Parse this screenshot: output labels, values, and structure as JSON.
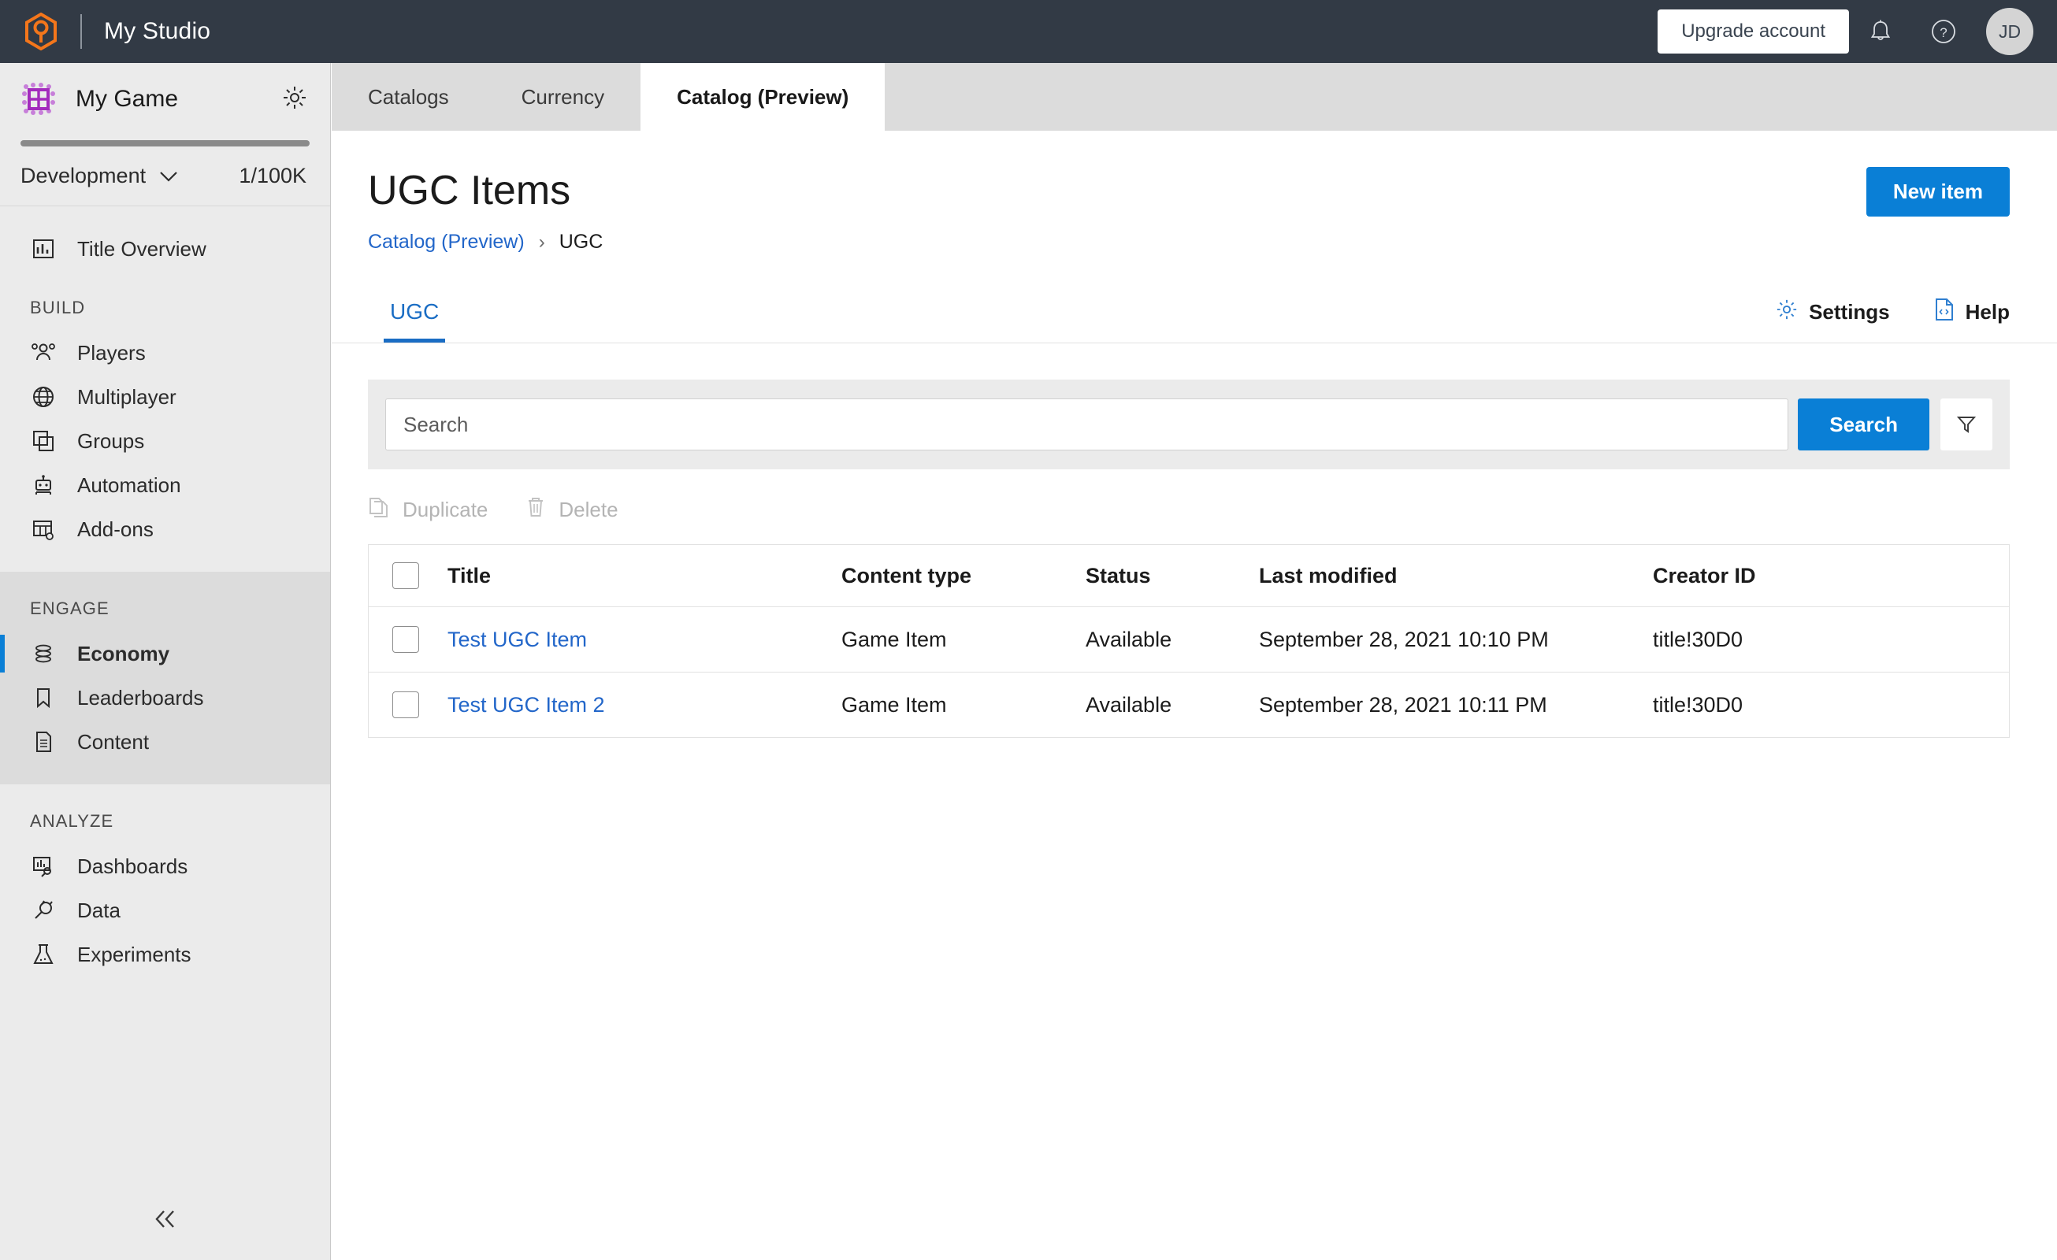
{
  "topbar": {
    "logo_icon": "playfab-hex-logo-icon",
    "studio_name": "My Studio",
    "upgrade_label": "Upgrade account",
    "bell_icon": "notification-bell-icon",
    "help_icon": "help-circle-icon",
    "avatar_initials": "JD",
    "bg_color": "#323a45",
    "logo_color": "#f4761b"
  },
  "sidebar": {
    "game_name": "My Game",
    "game_icon": "game-grid-icon",
    "gear_icon": "gear-icon",
    "environment": "Development",
    "env_chevron_icon": "chevron-down-icon",
    "quota": "1/100K",
    "title_overview": {
      "label": "Title Overview",
      "icon": "bar-chart-icon"
    },
    "sections": [
      {
        "heading": "BUILD",
        "items": [
          {
            "label": "Players",
            "icon": "people-icon"
          },
          {
            "label": "Multiplayer",
            "icon": "globe-icon"
          },
          {
            "label": "Groups",
            "icon": "stacked-squares-icon"
          },
          {
            "label": "Automation",
            "icon": "robot-icon"
          },
          {
            "label": "Add-ons",
            "icon": "table-gear-icon"
          }
        ]
      },
      {
        "heading": "ENGAGE",
        "active": true,
        "items": [
          {
            "label": "Economy",
            "icon": "coins-stack-icon",
            "selected": true
          },
          {
            "label": "Leaderboards",
            "icon": "bookmark-icon"
          },
          {
            "label": "Content",
            "icon": "document-lines-icon"
          }
        ]
      },
      {
        "heading": "ANALYZE",
        "items": [
          {
            "label": "Dashboards",
            "icon": "chart-search-icon"
          },
          {
            "label": "Data",
            "icon": "plug-icon"
          },
          {
            "label": "Experiments",
            "icon": "flask-icon"
          }
        ]
      }
    ],
    "collapse_icon": "double-chevron-left-icon",
    "accent_color": "#0a7fd6"
  },
  "tabs": [
    {
      "label": "Catalogs",
      "active": false
    },
    {
      "label": "Currency",
      "active": false
    },
    {
      "label": "Catalog (Preview)",
      "active": true
    }
  ],
  "page": {
    "title": "UGC Items",
    "new_item_label": "New item",
    "breadcrumb": {
      "link": "Catalog (Preview)",
      "separator": "›",
      "current": "UGC"
    },
    "subtab": "UGC",
    "settings_label": "Settings",
    "settings_icon": "gear-icon",
    "help_label": "Help",
    "help_icon": "document-code-icon"
  },
  "search": {
    "placeholder": "Search",
    "value": "",
    "button_label": "Search",
    "filter_icon": "funnel-filter-icon"
  },
  "actions": [
    {
      "label": "Duplicate",
      "icon": "copy-icon",
      "disabled": true
    },
    {
      "label": "Delete",
      "icon": "trash-icon",
      "disabled": true
    }
  ],
  "table": {
    "columns": [
      "Title",
      "Content type",
      "Status",
      "Last modified",
      "Creator ID"
    ],
    "rows": [
      {
        "title": "Test UGC Item",
        "content_type": "Game Item",
        "status": "Available",
        "last_modified": "September 28, 2021 10:10 PM",
        "creator_id": "title!30D0"
      },
      {
        "title": "Test UGC Item 2",
        "content_type": "Game Item",
        "status": "Available",
        "last_modified": "September 28, 2021 10:11 PM",
        "creator_id": "title!30D0"
      }
    ]
  }
}
